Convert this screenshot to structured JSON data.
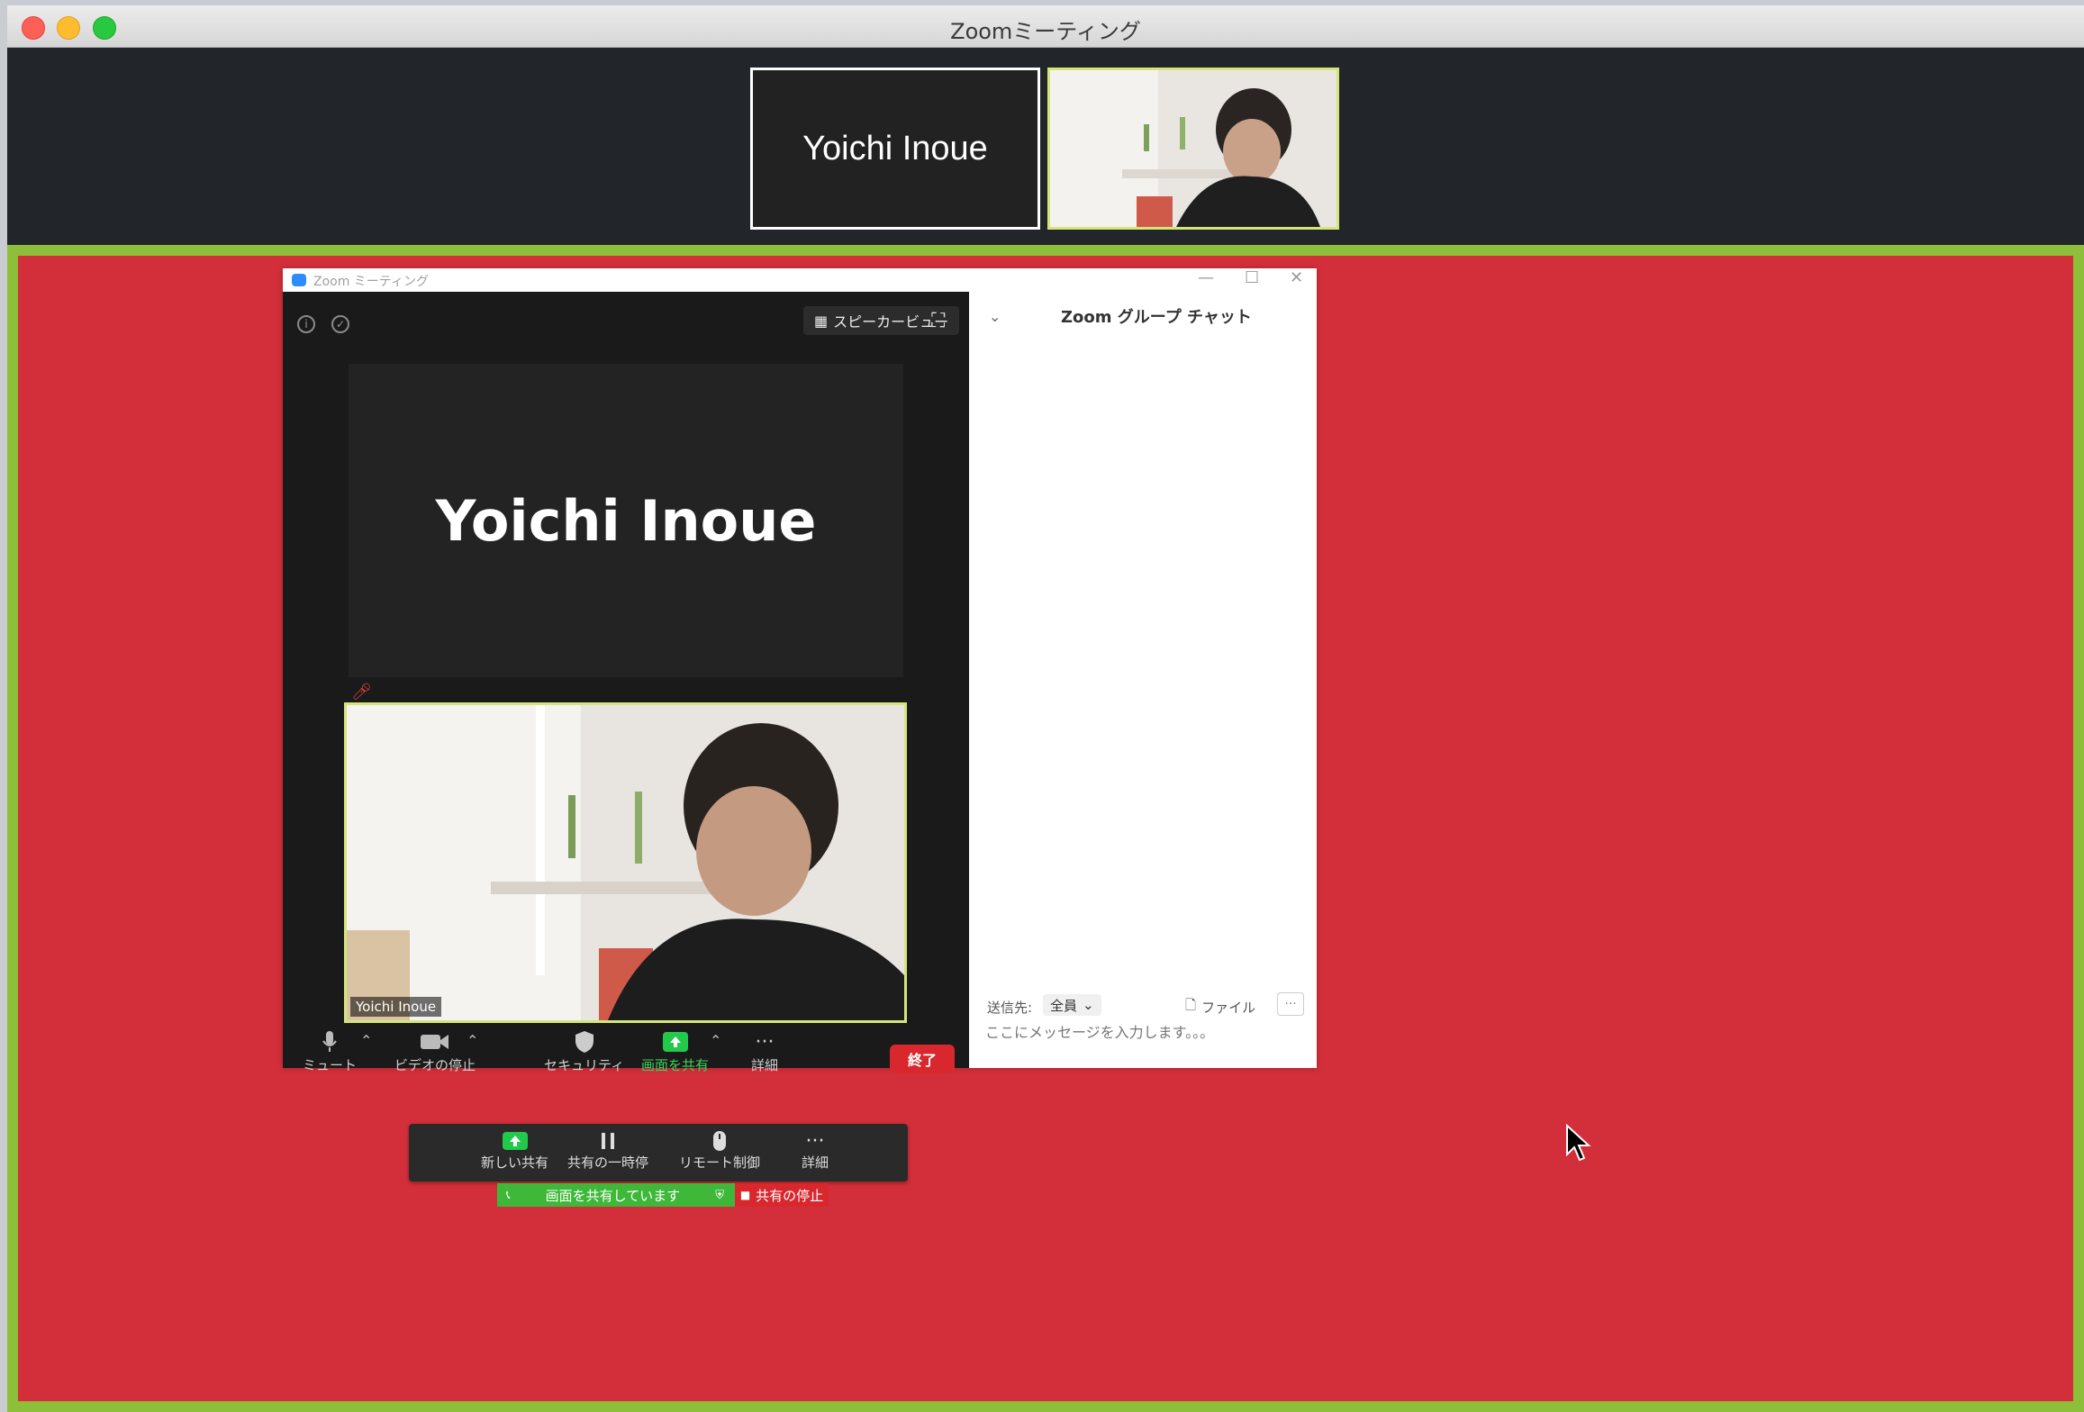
{
  "window": {
    "title": "Zoomミーティング"
  },
  "thumbnails": {
    "participant_name": "Yoichi Inoue"
  },
  "inner_window": {
    "title": "Zoom ミーティング",
    "speaker_view_label": "スピーカービュー",
    "participant_name": "Yoichi Inoue",
    "video_label": "Yoichi Inoue",
    "toolbar": {
      "mute": "ミュート",
      "stop_video": "ビデオの停止",
      "security": "セキュリティ",
      "share_screen": "画面を共有",
      "more": "詳細",
      "end": "終了"
    }
  },
  "chat": {
    "title": "Zoom グループ チャット",
    "to_label": "送信先:",
    "to_value": "全員",
    "file_label": "ファイル",
    "more_label": "···",
    "placeholder": "ここにメッセージを入力します。。。"
  },
  "share_toolbar": {
    "new_share": "新しい共有",
    "pause_share": "共有の一時停",
    "remote_control": "リモート制御",
    "more": "詳細",
    "status": "画面を共有しています",
    "stop": "共有の停止"
  },
  "colors": {
    "share_border": "#8dbf3b",
    "desktop": "#d32f3a",
    "active_green": "#3ad35a",
    "end_red": "#d8282e",
    "speaking_border": "#d4e67a"
  }
}
